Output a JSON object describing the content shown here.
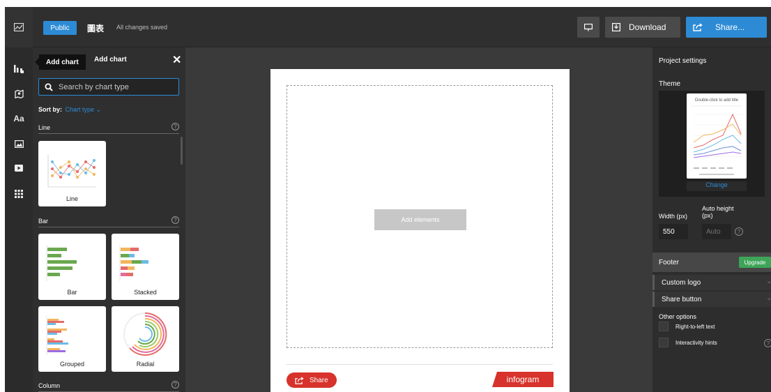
{
  "topbar": {
    "public_label": "Public",
    "project_name": "圖表",
    "save_status": "All changes saved",
    "download_label": "Download",
    "share_label": "Share..."
  },
  "rail": {
    "icons": [
      "project-icon",
      "chart-icon",
      "map-icon",
      "text-icon",
      "image-icon",
      "video-icon",
      "grid-icon"
    ],
    "text_icon_label": "Aa"
  },
  "panel": {
    "tooltip": "Add chart",
    "title": "Add chart",
    "close_label": "✕",
    "search_placeholder": "Search by chart type",
    "sort_label": "Sort by:",
    "sort_value": "Chart type ⌄",
    "sections": {
      "line": "Line",
      "bar": "Bar",
      "column": "Column"
    },
    "help_glyph": "?",
    "cards": {
      "line": "Line",
      "bar": "Bar",
      "stacked": "Stacked",
      "grouped": "Grouped",
      "radial": "Radial"
    }
  },
  "canvas": {
    "add_elements": "Add elements",
    "share_label": "Share",
    "brand": "infogram"
  },
  "settings": {
    "title": "Project settings",
    "theme_label": "Theme",
    "theme_preview_title": "Double-click to add title",
    "theme_change": "Change",
    "width_label": "Width (px)",
    "width_value": "550",
    "auto_height_label_1": "Auto height",
    "auto_height_label_2": "(px)",
    "auto_placeholder": "Auto",
    "footer_label": "Footer",
    "upgrade_label": "Upgrade",
    "custom_logo": "Custom logo",
    "share_button": "Share button",
    "chevron": "⌄",
    "other_options": "Other options",
    "rtl_text": "Right-to-left text",
    "interactivity_hints": "Interactivity hints"
  },
  "colors": {
    "accent": "#2d8bd5",
    "upgrade": "#3da558",
    "brand_red": "#d7322b"
  }
}
